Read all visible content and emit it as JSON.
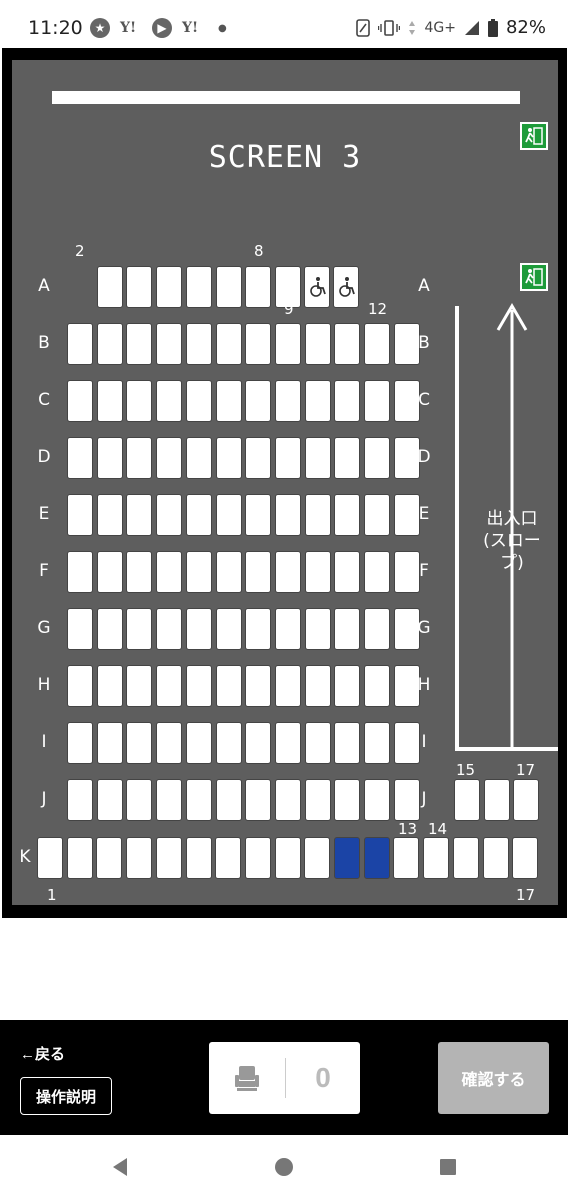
{
  "status_bar": {
    "time": "11:20",
    "left_icons": [
      "star-circle-icon",
      "yahoo-icon",
      "play-circle-icon",
      "yahoo-icon",
      "dot-icon"
    ],
    "yahoo_text": "Y!",
    "network": "4G+",
    "battery": "82%"
  },
  "map": {
    "screen_title": "SCREEN 3",
    "rows": [
      "A",
      "B",
      "C",
      "D",
      "E",
      "F",
      "G",
      "H",
      "I",
      "J",
      "K"
    ],
    "seat_numbers": {
      "a_left_start": "2",
      "a_left_end": "8",
      "a_right_start": "9",
      "a_right_end": "12",
      "j_right_start": "15",
      "j_right_end": "17",
      "k_right_start": "13",
      "k_right_next": "14",
      "k_start": "1",
      "k_end": "17"
    },
    "slope_label_line1": "出入口",
    "slope_label_line2": "(スロープ)",
    "selected_seats": [
      "K11",
      "K12"
    ],
    "colors": {
      "background": "#5e5e5e",
      "selected": "#1b44a6",
      "exit": "#1e9b3a"
    }
  },
  "bottom_bar": {
    "back_label": "←戻る",
    "help_label": "操作説明",
    "selected_count": "0",
    "confirm_label": "確認する"
  }
}
